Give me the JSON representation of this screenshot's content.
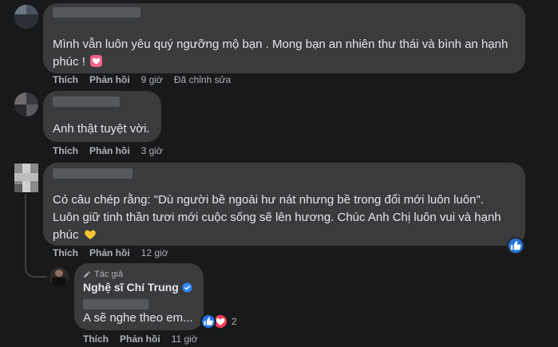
{
  "comments": [
    {
      "text": "Mình vẫn luôn yêu quý ngưỡng mộ bạn . Mong bạn an nhiên thư thái và bình an hạnh phúc !",
      "like_label": "Thích",
      "reply_label": "Phản hồi",
      "time": "9 giờ",
      "edited": "Đã chỉnh sửa",
      "emoji_icon": "heart-emoji-icon"
    },
    {
      "text": "Anh thật tuyệt vời.",
      "like_label": "Thích",
      "reply_label": "Phản hồi",
      "time": "3 giờ"
    },
    {
      "text_line1": "Có câu chép rằng: \"Dù người bề ngoài hư nát nhưng bề trong đổi mới luôn luôn\".",
      "text_line2": "Luôn giữ tinh thần tươi mới cuộc sống sẽ lên hương. Chúc Anh Chị luôn vui và hạnh",
      "text_line3": "phúc",
      "like_label": "Thích",
      "reply_label": "Phản hồi",
      "time": "12 giờ",
      "emoji_icon": "yellow-heart-icon",
      "reaction_icon": "like-reaction-icon"
    }
  ],
  "reply": {
    "author_badge": "Tác giả",
    "author_name": "Nghệ sĩ Chí Trung",
    "text": "A sẽ nghe theo em...",
    "like_label": "Thích",
    "reply_label": "Phản hồi",
    "time": "11 giờ",
    "reaction_count": "2",
    "reaction_icons": [
      "like-reaction-icon",
      "love-reaction-icon"
    ]
  },
  "colors": {
    "background": "#18191a",
    "bubble": "#3a3b3c",
    "text": "#e4e6eb",
    "meta": "#b0b3b8",
    "like_blue": "#2374e1",
    "love_red": "#f33e58",
    "verified_blue": "#2d88ff"
  }
}
